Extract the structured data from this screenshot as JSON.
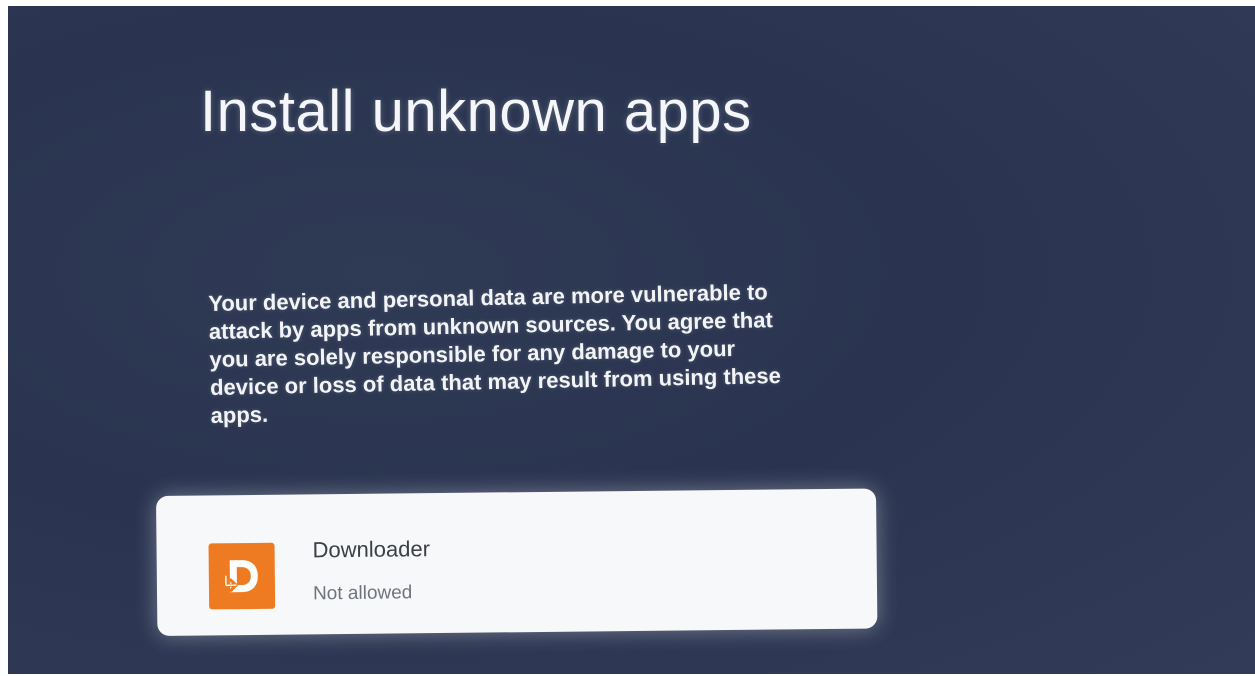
{
  "page": {
    "title": "Install unknown apps",
    "description": "Your device and personal data are more vulnerable to attack by apps from unknown sources. You agree that you are solely responsible for any damage to your device or loss of data that may result from using these apps."
  },
  "apps": [
    {
      "name": "Downloader",
      "status": "Not allowed",
      "icon": "downloader-icon",
      "icon_color": "#EE7A22"
    }
  ],
  "colors": {
    "background": "#2C3652",
    "text": "#F4F6FA",
    "card": "#F7F8FA"
  }
}
